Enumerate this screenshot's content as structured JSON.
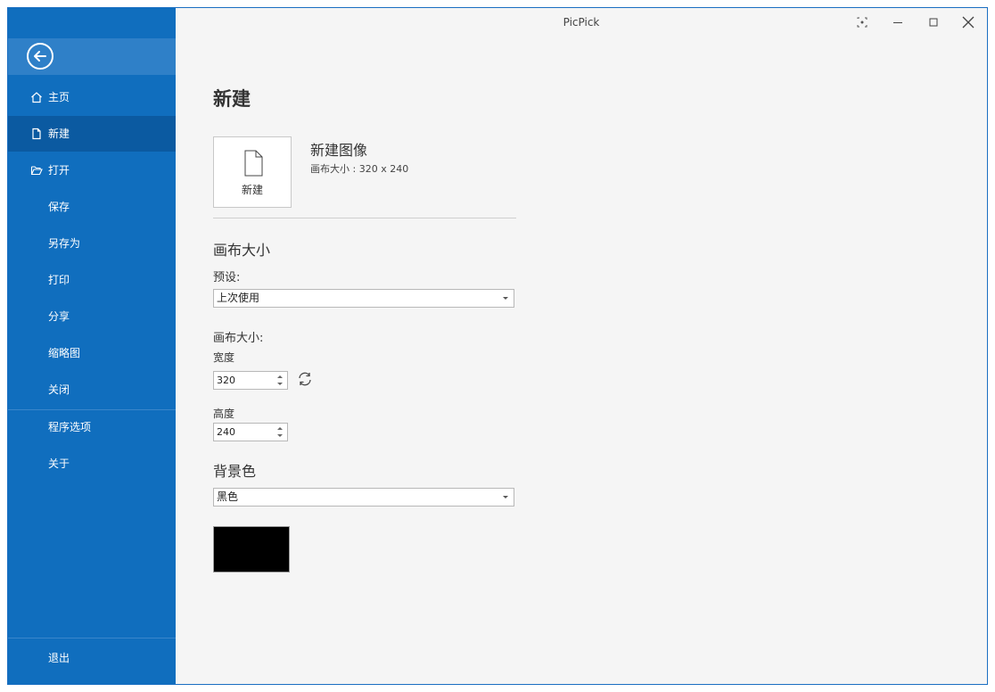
{
  "app": {
    "title": "PicPick"
  },
  "sidebar": {
    "items": [
      {
        "label": "主页",
        "icon": "home-icon"
      },
      {
        "label": "新建",
        "icon": "new-document-icon",
        "active": true
      },
      {
        "label": "打开",
        "icon": "folder-open-icon"
      },
      {
        "label": "保存"
      },
      {
        "label": "另存为"
      },
      {
        "label": "打印"
      },
      {
        "label": "分享"
      },
      {
        "label": "缩略图"
      },
      {
        "label": "关闭"
      },
      {
        "label": "程序选项"
      },
      {
        "label": "关于"
      }
    ],
    "exit_label": "退出"
  },
  "main": {
    "heading": "新建",
    "new_tile_label": "新建",
    "new_image": {
      "title": "新建图像",
      "subtitle": "画布大小 : 320 x 240"
    },
    "canvas_section": "画布大小",
    "preset_label": "预设:",
    "preset_value": "上次使用",
    "canvas_size_label": "画布大小:",
    "width_label": "宽度",
    "width_value": "320",
    "height_label": "高度",
    "height_value": "240",
    "background_section": "背景色",
    "background_value": "黑色",
    "background_color": "#000000"
  },
  "colors": {
    "sidebar": "#106ebe",
    "sidebar_active": "#0b5aa1",
    "background": "#f5f5f5"
  }
}
